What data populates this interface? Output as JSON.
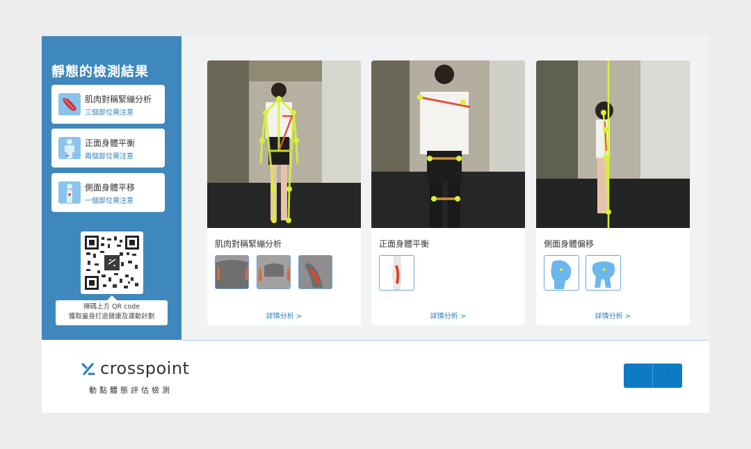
{
  "sidebar": {
    "title": "靜態的檢測結果",
    "cards": [
      {
        "title": "肌肉對稱緊繃分析",
        "subtitle": "三個部位需注意",
        "icon": "muscle-icon"
      },
      {
        "title": "正面身體平衡",
        "subtitle": "兩個部位需注意",
        "icon": "front-body-icon"
      },
      {
        "title": "側面身體平移",
        "subtitle": "一個部位需注意",
        "icon": "side-body-icon"
      }
    ],
    "qr_tip_line1": "掃碼上方 QR code",
    "qr_tip_line2": "獲取量身打造健康及運動計劃"
  },
  "panels": [
    {
      "title": "肌肉對稱緊繃分析",
      "detail": "詳情分析 >",
      "images": [
        "shoulder-muscle-back",
        "chest-muscle-front",
        "arm-muscle"
      ]
    },
    {
      "title": "正面身體平衡",
      "detail": "詳情分析 >",
      "images": [
        "knee-joint"
      ]
    },
    {
      "title": "側面身體偏移",
      "detail": "詳情分析 >",
      "images": [
        "head-side",
        "pelvis"
      ]
    }
  ],
  "footer": {
    "brand": "crosspoint",
    "brand_sub": "動點體態評估檢測",
    "prev": "‹",
    "next": "›"
  },
  "colors": {
    "accent": "#3f88bd",
    "pose": "#d8f135",
    "warn": "#e0533a",
    "button": "#0d7bc4"
  }
}
